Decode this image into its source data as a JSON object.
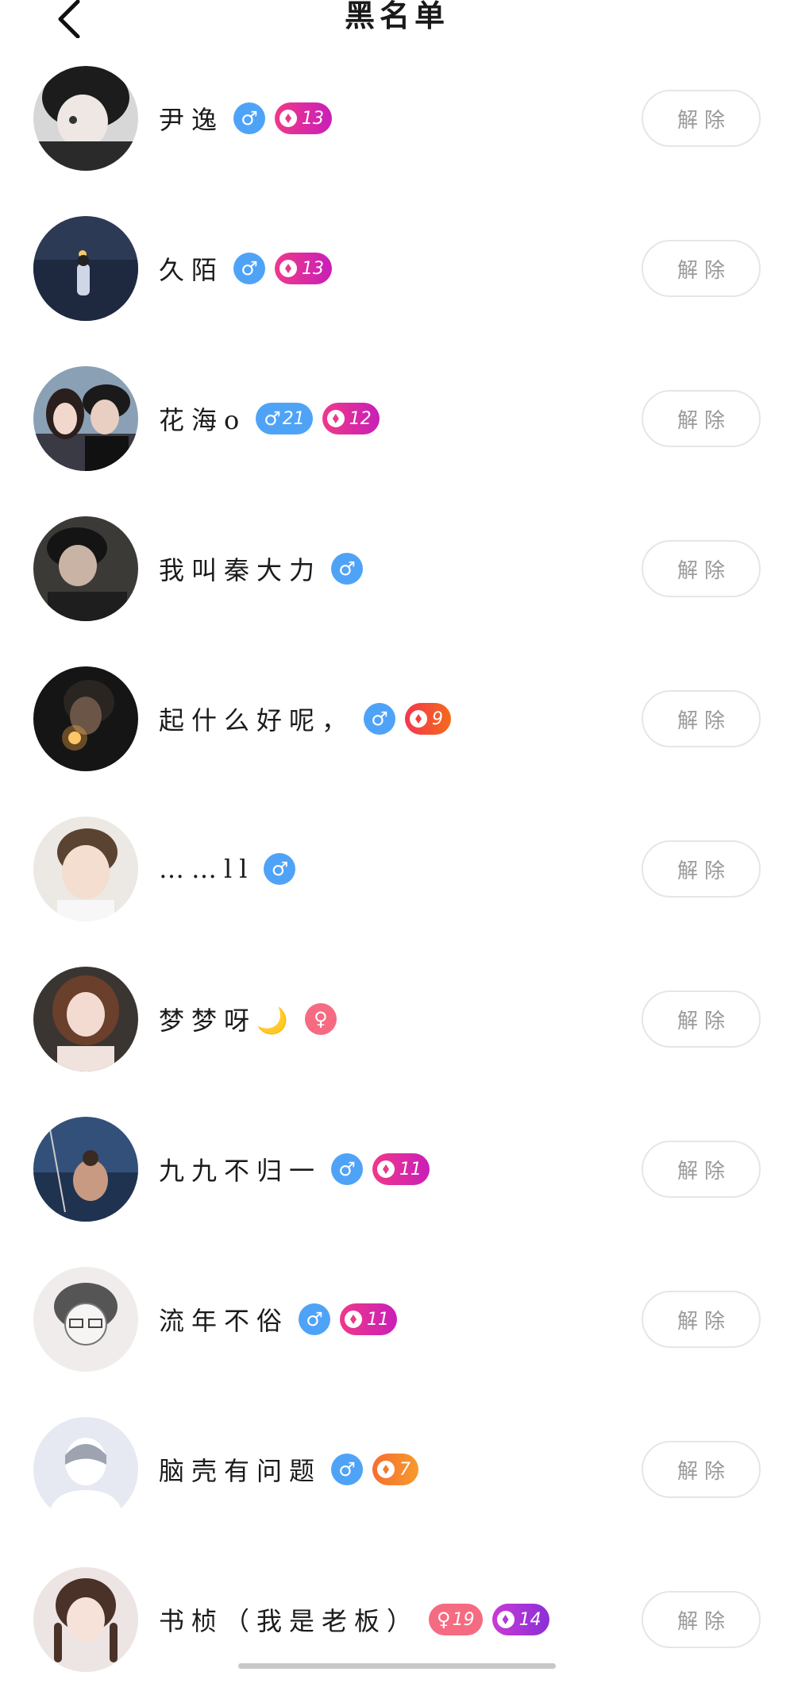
{
  "header": {
    "title": "黑名单",
    "back_icon": "chevron-left-icon"
  },
  "colors": {
    "male": "#4fa3f7",
    "female": "#f56b81",
    "button_border": "#e6e6e6",
    "button_text": "#9a9a9a"
  },
  "rows": [
    {
      "name": "尹逸",
      "gender_symbol": "♂",
      "gender_num": "",
      "badges": [
        {
          "label": "13",
          "style": "pink"
        }
      ],
      "button": "解除",
      "avatar": "avatar-dark-boy"
    },
    {
      "name": "久陌",
      "gender_symbol": "♂",
      "gender_num": "",
      "badges": [
        {
          "label": "13",
          "style": "pink"
        }
      ],
      "button": "解除",
      "avatar": "avatar-sea-night"
    },
    {
      "name": "花海o",
      "gender_symbol": "♂",
      "gender_num": "21",
      "badges": [
        {
          "label": "12",
          "style": "pink"
        }
      ],
      "button": "解除",
      "avatar": "avatar-couple"
    },
    {
      "name": "我叫秦大力",
      "gender_symbol": "♂",
      "gender_num": "",
      "badges": [],
      "button": "解除",
      "avatar": "avatar-man-dark"
    },
    {
      "name": "起什么好呢，",
      "gender_symbol": "♂",
      "gender_num": "",
      "badges": [
        {
          "label": "9",
          "style": "red"
        }
      ],
      "button": "解除",
      "avatar": "avatar-lighter"
    },
    {
      "name": "……ll",
      "gender_symbol": "♂",
      "gender_num": "",
      "badges": [],
      "button": "解除",
      "avatar": "avatar-child"
    },
    {
      "name": "梦梦呀🌙",
      "gender_symbol": "♀",
      "gender_num": "",
      "badges": [],
      "button": "解除",
      "avatar": "avatar-girl"
    },
    {
      "name": "九九不归一",
      "gender_symbol": "♂",
      "gender_num": "",
      "badges": [
        {
          "label": "11",
          "style": "pink"
        }
      ],
      "button": "解除",
      "avatar": "avatar-fishing"
    },
    {
      "name": "流年不俗",
      "gender_symbol": "♂",
      "gender_num": "",
      "badges": [
        {
          "label": "11",
          "style": "pink"
        }
      ],
      "button": "解除",
      "avatar": "avatar-sketch"
    },
    {
      "name": "脑壳有问题",
      "gender_symbol": "♂",
      "gender_num": "",
      "badges": [
        {
          "label": "7",
          "style": "orange"
        }
      ],
      "button": "解除",
      "avatar": "avatar-default"
    },
    {
      "name": "书桢（我是老板）",
      "gender_symbol": "♀",
      "gender_num": "19",
      "badges": [
        {
          "label": "14",
          "style": "purple"
        }
      ],
      "button": "解除",
      "avatar": "avatar-braids-girl"
    }
  ]
}
